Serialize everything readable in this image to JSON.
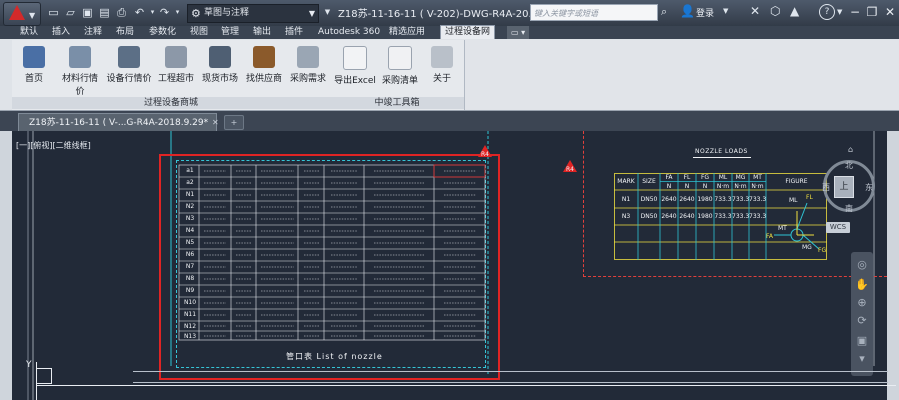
{
  "title_bar": {
    "workspace": "草图与注释",
    "window_title": "Z18苏-11-16-11 ( V-202)-DWG-R4A-20...",
    "search_placeholder": "键入关键字或短语",
    "login": "登录"
  },
  "ribbon_tabs": [
    "默认",
    "插入",
    "注释",
    "布局",
    "参数化",
    "视图",
    "管理",
    "输出",
    "插件",
    "Autodesk 360",
    "精选应用",
    "过程设备网"
  ],
  "active_tab": "过程设备网",
  "ribbon_groups": [
    {
      "label": "过程设备商城",
      "buttons": [
        "首页",
        "材料行情价",
        "设备行情价",
        "工程超市",
        "现货市场",
        "找供应商",
        "采购需求"
      ]
    },
    {
      "label": "中竣工具箱",
      "buttons": [
        "导出Excel",
        "采购清单",
        "关于"
      ]
    }
  ],
  "document_tab": "Z18苏-11-16-11 ( V-...G-R4A-2018.9.29*",
  "viewport_label": "[一][俯视][二维线框]",
  "nozzle_table": {
    "title": "NOZZLE LOADS",
    "headers": [
      "MARK",
      "SIZE",
      "FA\nN",
      "FL\nN",
      "FG\nN",
      "ML\nN·m",
      "MG\nN·m",
      "MT\nN·m",
      "FIGURE"
    ],
    "rows": [
      [
        "N1",
        "DN50",
        "2640",
        "2640",
        "1980",
        "733.3",
        "733.3",
        "733.3"
      ],
      [
        "N3",
        "DN50",
        "2640",
        "2640",
        "1980",
        "733.3",
        "733.3",
        "733.3"
      ]
    ],
    "figure_labels": [
      "FL",
      "ML",
      "FA",
      "MT",
      "MG",
      "FG"
    ]
  },
  "markers": {
    "r4_top": "R4",
    "r4_mid": "R4"
  },
  "left_table": {
    "marks": [
      "a1",
      "a2",
      "N1",
      "N2",
      "N3",
      "N4",
      "N5",
      "N6",
      "N7",
      "N8",
      "N9",
      "N10",
      "N11",
      "N12",
      "N13"
    ],
    "footer": "管口表   List of nozzle"
  },
  "viewcube": {
    "n": "北",
    "s": "南",
    "w": "西",
    "e": "东",
    "face": "上",
    "wcs": "WCS"
  },
  "ucs": {
    "y": "Y"
  }
}
